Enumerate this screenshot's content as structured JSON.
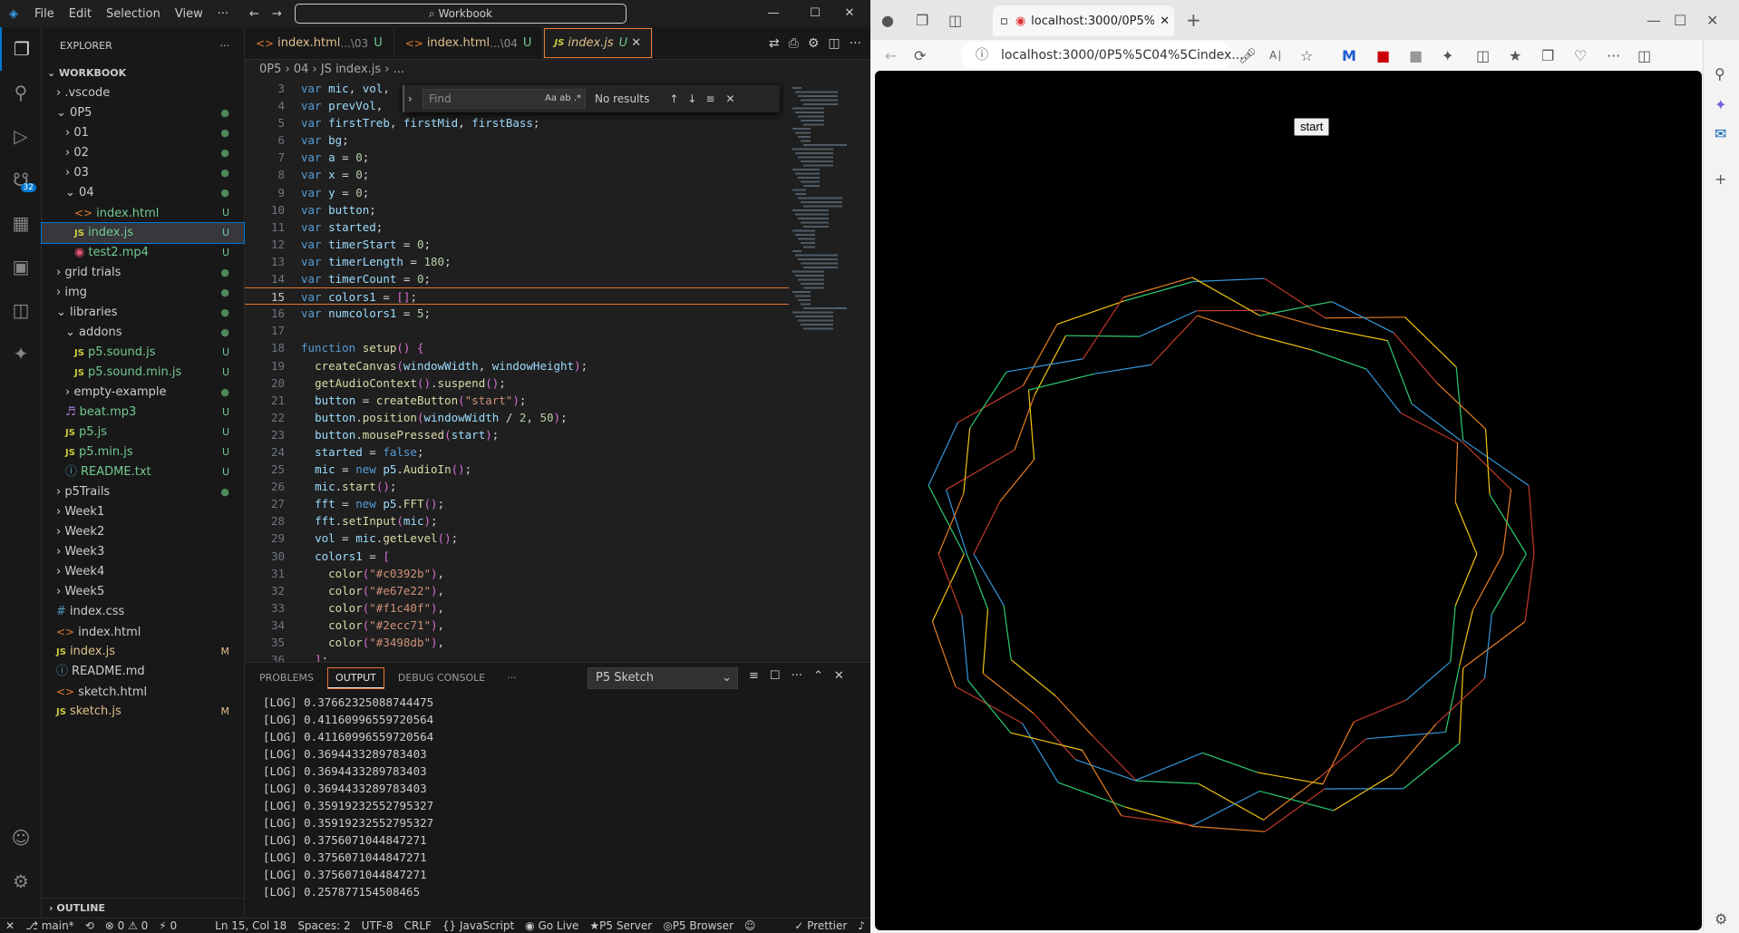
{
  "vscode": {
    "menu": [
      "File",
      "Edit",
      "Selection",
      "View",
      "···"
    ],
    "search": "⌕ Workbook",
    "sidebar": {
      "title": "EXPLORER",
      "workspace": "WORKBOOK",
      "items": [
        {
          "label": ".vscode",
          "indent": 1,
          "type": "folder",
          "status": ""
        },
        {
          "label": "0P5",
          "indent": 1,
          "type": "folder-open",
          "status": "dot"
        },
        {
          "label": "01",
          "indent": 2,
          "type": "folder",
          "status": "dot"
        },
        {
          "label": "02",
          "indent": 2,
          "type": "folder",
          "status": "dot"
        },
        {
          "label": "03",
          "indent": 2,
          "type": "folder",
          "status": "dot"
        },
        {
          "label": "04",
          "indent": 2,
          "type": "folder-open",
          "status": "dot"
        },
        {
          "label": "index.html",
          "indent": 3,
          "type": "html",
          "status": "U"
        },
        {
          "label": "index.js",
          "indent": 3,
          "type": "js",
          "status": "U",
          "selected": true
        },
        {
          "label": "test2.mp4",
          "indent": 3,
          "type": "media",
          "status": "U"
        },
        {
          "label": "grid trials",
          "indent": 1,
          "type": "folder",
          "status": "dot"
        },
        {
          "label": "img",
          "indent": 1,
          "type": "folder",
          "status": "dot"
        },
        {
          "label": "libraries",
          "indent": 1,
          "type": "folder-open",
          "status": "dot"
        },
        {
          "label": "addons",
          "indent": 2,
          "type": "folder-open",
          "status": "dot"
        },
        {
          "label": "p5.sound.js",
          "indent": 3,
          "type": "js",
          "status": "U"
        },
        {
          "label": "p5.sound.min.js",
          "indent": 3,
          "type": "js",
          "status": "U"
        },
        {
          "label": "empty-example",
          "indent": 2,
          "type": "folder",
          "status": "dot"
        },
        {
          "label": "beat.mp3",
          "indent": 2,
          "type": "audio",
          "status": "U"
        },
        {
          "label": "p5.js",
          "indent": 2,
          "type": "js",
          "status": "U"
        },
        {
          "label": "p5.min.js",
          "indent": 2,
          "type": "js",
          "status": "U"
        },
        {
          "label": "README.txt",
          "indent": 2,
          "type": "info",
          "status": "U"
        },
        {
          "label": "p5Trails",
          "indent": 1,
          "type": "folder",
          "status": "dot"
        },
        {
          "label": "Week1",
          "indent": 1,
          "type": "folder",
          "status": ""
        },
        {
          "label": "Week2",
          "indent": 1,
          "type": "folder",
          "status": ""
        },
        {
          "label": "Week3",
          "indent": 1,
          "type": "folder",
          "status": ""
        },
        {
          "label": "Week4",
          "indent": 1,
          "type": "folder",
          "status": ""
        },
        {
          "label": "Week5",
          "indent": 1,
          "type": "folder",
          "status": ""
        },
        {
          "label": "index.css",
          "indent": 1,
          "type": "css",
          "status": ""
        },
        {
          "label": "index.html",
          "indent": 1,
          "type": "html",
          "status": ""
        },
        {
          "label": "index.js",
          "indent": 1,
          "type": "js",
          "status": "M"
        },
        {
          "label": "README.md",
          "indent": 1,
          "type": "info",
          "status": ""
        },
        {
          "label": "sketch.html",
          "indent": 1,
          "type": "html",
          "status": ""
        },
        {
          "label": "sketch.js",
          "indent": 1,
          "type": "js",
          "status": "M"
        }
      ],
      "outline": "OUTLINE"
    },
    "tabs": [
      {
        "label": "index.html",
        "path": "...\\03",
        "status": "U"
      },
      {
        "label": "index.html",
        "path": "...\\04",
        "status": "U"
      },
      {
        "label": "index.js",
        "path": "",
        "status": "U",
        "active": true
      }
    ],
    "breadcrumb": "0P5 › 04 › JS index.js › ...",
    "find": {
      "placeholder": "Find",
      "result": "No results",
      "opts": "Aa  ab  .*"
    },
    "code": [
      {
        "n": "3",
        "t": "var mic, vol, "
      },
      {
        "n": "4",
        "t": "var prevVol, "
      },
      {
        "n": "5",
        "t": "var firstTreb, firstMid, firstBass;"
      },
      {
        "n": "6",
        "t": "var bg;"
      },
      {
        "n": "7",
        "t": "var a = 0;"
      },
      {
        "n": "8",
        "t": "var x = 0;"
      },
      {
        "n": "9",
        "t": "var y = 0;"
      },
      {
        "n": "10",
        "t": "var button;"
      },
      {
        "n": "11",
        "t": "var started;"
      },
      {
        "n": "12",
        "t": "var timerStart = 0;"
      },
      {
        "n": "13",
        "t": "var timerLength = 180;"
      },
      {
        "n": "14",
        "t": "var timerCount = 0;"
      },
      {
        "n": "15",
        "t": "var colors1 = [];",
        "cur": true
      },
      {
        "n": "16",
        "t": "var numcolors1 = 5;"
      },
      {
        "n": "17",
        "t": ""
      },
      {
        "n": "18",
        "t": "function setup() {"
      },
      {
        "n": "19",
        "t": "  createCanvas(windowWidth, windowHeight);"
      },
      {
        "n": "20",
        "t": "  getAudioContext().suspend();"
      },
      {
        "n": "21",
        "t": "  button = createButton(\"start\");"
      },
      {
        "n": "22",
        "t": "  button.position(windowWidth / 2, 50);"
      },
      {
        "n": "23",
        "t": "  button.mousePressed(start);"
      },
      {
        "n": "24",
        "t": "  started = false;"
      },
      {
        "n": "25",
        "t": "  mic = new p5.AudioIn();"
      },
      {
        "n": "26",
        "t": "  mic.start();"
      },
      {
        "n": "27",
        "t": "  fft = new p5.FFT();"
      },
      {
        "n": "28",
        "t": "  fft.setInput(mic);"
      },
      {
        "n": "29",
        "t": "  vol = mic.getLevel();"
      },
      {
        "n": "30",
        "t": "  colors1 = ["
      },
      {
        "n": "31",
        "t": "    color(\"#c0392b\"),"
      },
      {
        "n": "32",
        "t": "    color(\"#e67e22\"),"
      },
      {
        "n": "33",
        "t": "    color(\"#f1c40f\"),"
      },
      {
        "n": "34",
        "t": "    color(\"#2ecc71\"),"
      },
      {
        "n": "35",
        "t": "    color(\"#3498db\"),"
      },
      {
        "n": "36",
        "t": "  ];"
      }
    ],
    "panel": {
      "tabs": [
        "PROBLEMS",
        "OUTPUT",
        "DEBUG CONSOLE",
        "···"
      ],
      "select": "P5 Sketch",
      "logs": [
        "[LOG] 0.37662325088744475",
        "[LOG] 0.41160996559720564",
        "[LOG] 0.41160996559720564",
        "[LOG] 0.3694433289783403",
        "[LOG] 0.3694433289783403",
        "[LOG] 0.3694433289783403",
        "[LOG] 0.35919232552795327",
        "[LOG] 0.35919232552795327",
        "[LOG] 0.3756071044847271",
        "[LOG] 0.3756071044847271",
        "[LOG] 0.3756071044847271",
        "[LOG] 0.257877154508465"
      ]
    },
    "status": [
      "⎇ main*",
      "⟲",
      "⊗ 0 ⚠ 0",
      "⚡ 0",
      "Ln 15, Col 18",
      "Spaces: 2",
      "UTF-8",
      "CRLF",
      "{} JavaScript",
      "◉ Go Live",
      "★P5 Server",
      "◎P5 Browser",
      "☺",
      "✓ Prettier",
      "♪"
    ]
  },
  "browser": {
    "tab_title": "localhost:3000/0P5%5C04%",
    "url": "localhost:3000/0P5%5C04%5Cindex....",
    "start_button": "start",
    "colors": [
      "#c0392b",
      "#e67e22",
      "#f1c40f",
      "#2ecc71",
      "#3498db"
    ]
  }
}
